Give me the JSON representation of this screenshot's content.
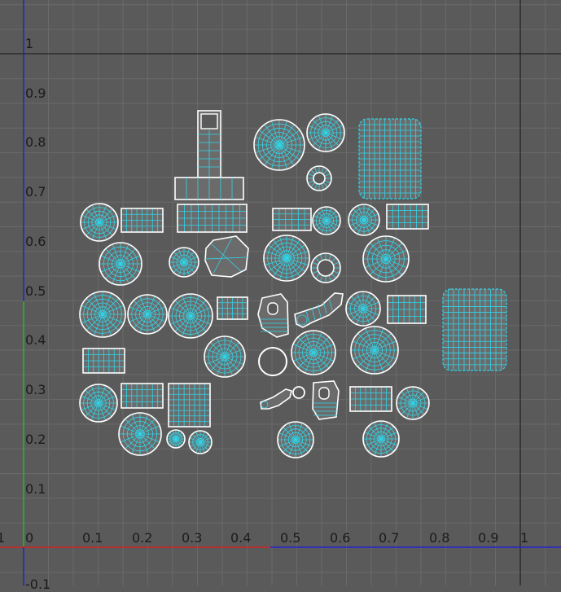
{
  "editor": {
    "name": "UV Editor",
    "grid": true,
    "colors": {
      "background": "#5a5a5a",
      "grid_minor": "#6a6a6a",
      "grid_major": "#4e4e4e",
      "uv_border": "#ffffff",
      "uv_wire": "#2fd6ea",
      "uv_fill": "#6b6b6b",
      "axis_u": "#cc2222",
      "axis_v": "#22bb22",
      "axis_blue": "#2222cc",
      "frame_black": "#111111"
    }
  },
  "axes": {
    "v_labels": [
      "1",
      "0.9",
      "0.8",
      "0.7",
      "0.6",
      "0.5",
      "0.4",
      "0.3",
      "0.2",
      "0.1",
      "-0.1"
    ],
    "u_labels": [
      "0",
      "0.1",
      "0.2",
      "0.3",
      "0.4",
      "0.5",
      "0.6",
      "0.7",
      "0.8",
      "0.9",
      "1"
    ],
    "left_edge_label": "1"
  }
}
